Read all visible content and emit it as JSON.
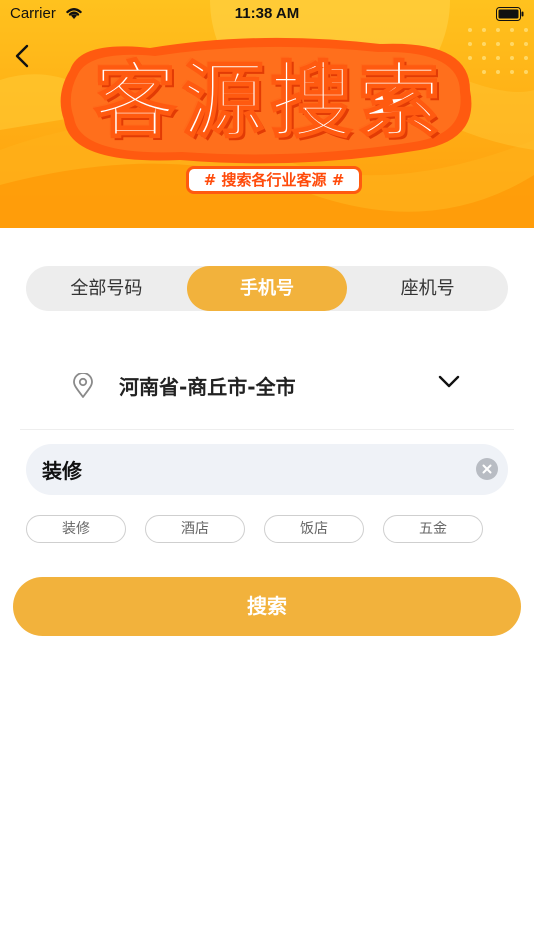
{
  "status_bar": {
    "carrier": "Carrier",
    "time": "11:38 AM"
  },
  "banner": {
    "title": "客源搜索",
    "subtitle": "# 搜索各行业客源 #"
  },
  "tabs": [
    {
      "label": "全部号码",
      "active": false
    },
    {
      "label": "手机号",
      "active": true
    },
    {
      "label": "座机号",
      "active": false
    }
  ],
  "location": {
    "value": "河南省-商丘市-全市"
  },
  "search": {
    "value": "装修"
  },
  "tags": [
    "装修",
    "酒店",
    "饭店",
    "五金"
  ],
  "search_button": {
    "label": "搜索"
  },
  "colors": {
    "accent": "#f2b23c",
    "banner_orange": "#ff5a10",
    "banner_yellow": "#ffb21a"
  }
}
